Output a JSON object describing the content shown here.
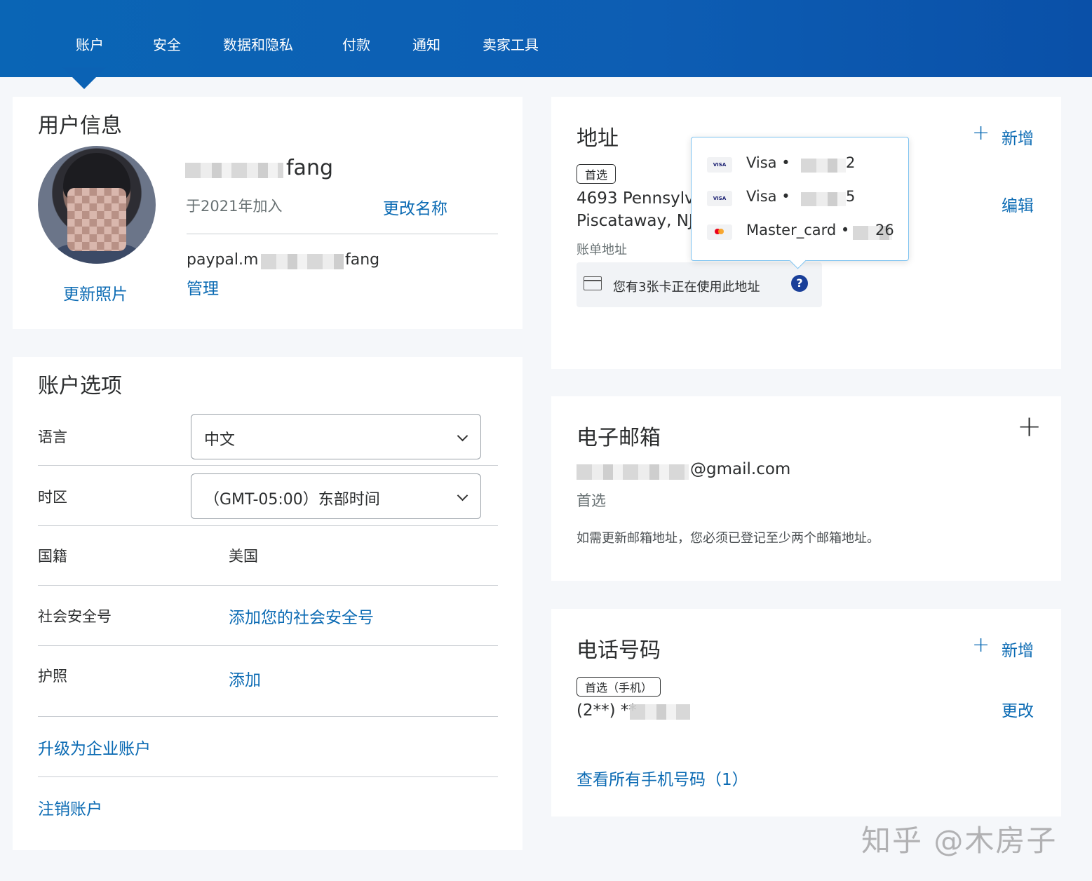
{
  "nav": {
    "tabs": [
      "账户",
      "安全",
      "数据和隐私",
      "付款",
      "通知",
      "卖家工具"
    ]
  },
  "user_info": {
    "title": "用户信息",
    "name_suffix": "fang",
    "joined": "于2021年加入",
    "change_name": "更改名称",
    "paypal_me_prefix": "paypal.m",
    "paypal_me_suffix": "fang",
    "manage": "管理",
    "update_photo": "更新照片"
  },
  "account_options": {
    "title": "账户选项",
    "language_label": "语言",
    "language_value": "中文",
    "timezone_label": "时区",
    "timezone_value": "（GMT-05:00）东部时间",
    "nationality_label": "国籍",
    "nationality_value": "美国",
    "ssn_label": "社会安全号",
    "ssn_link": "添加您的社会安全号",
    "passport_label": "护照",
    "passport_link": "添加",
    "upgrade": "升级为企业账户",
    "close_account": "注销账户"
  },
  "address": {
    "title": "地址",
    "add": "新增",
    "badge": "首选",
    "line1": "4693 Pennsylv",
    "line2": "Piscataway, NJ",
    "billing": "账单地址",
    "edit": "编辑",
    "cards_note": "您有3张卡正在使用此地址"
  },
  "popover": {
    "cards": [
      {
        "brand": "Visa",
        "label": "Visa •",
        "tail": "2",
        "logo": "VISA"
      },
      {
        "brand": "Visa",
        "label": "Visa •",
        "tail": "5",
        "logo": "VISA"
      },
      {
        "brand": "Mastercard",
        "label": "Master_card •",
        "tail": "26",
        "logo": ""
      }
    ]
  },
  "email": {
    "title": "电子邮箱",
    "domain": "@gmail.com",
    "preferred": "首选",
    "note": "如需更新邮箱地址，您必须已登记至少两个邮箱地址。"
  },
  "phone": {
    "title": "电话号码",
    "add": "新增",
    "badge": "首选（手机）",
    "number": "(2**) **",
    "change": "更改",
    "view_all": "查看所有手机号码（1）"
  },
  "watermark": "知乎 @木房子",
  "colors": {
    "nav_blue": "#0a65b5",
    "link_blue": "#0a6ab3",
    "help_blue": "#1a3f99"
  }
}
